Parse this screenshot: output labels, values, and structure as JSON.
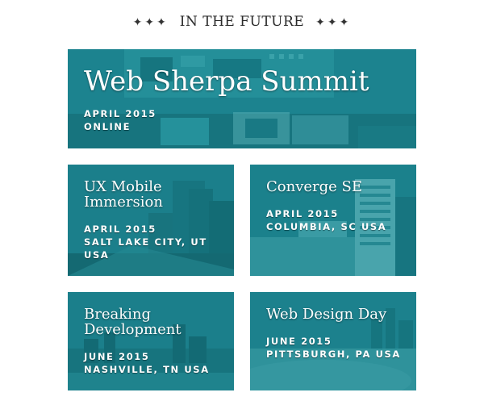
{
  "section": {
    "stars_left": "✦✦✦",
    "title": "IN THE FUTURE",
    "stars_right": "✦✦✦"
  },
  "events": [
    {
      "title": "Web Sherpa Summit",
      "date": "APRIL 2015",
      "location": "ONLINE"
    },
    {
      "title": "UX Mobile Immersion",
      "date": "APRIL 2015",
      "location": "SALT LAKE CITY, UT USA"
    },
    {
      "title": "Converge SE",
      "date": "APRIL 2015",
      "location": "COLUMBIA, SC USA"
    },
    {
      "title": "Breaking Development",
      "date": "JUNE 2015",
      "location": "NASHVILLE, TN USA"
    },
    {
      "title": "Web Design Day",
      "date": "JUNE 2015",
      "location": "PITTSBURGH, PA USA"
    }
  ],
  "colors": {
    "teal": "#1d7f8b",
    "teal_dark": "#0f5a63",
    "heading": "#2a2a2a"
  },
  "images": [
    "circuit-board-image",
    "city-skyline-image",
    "office-buildings-image",
    "riverside-skyline-image",
    "stadium-city-image"
  ]
}
